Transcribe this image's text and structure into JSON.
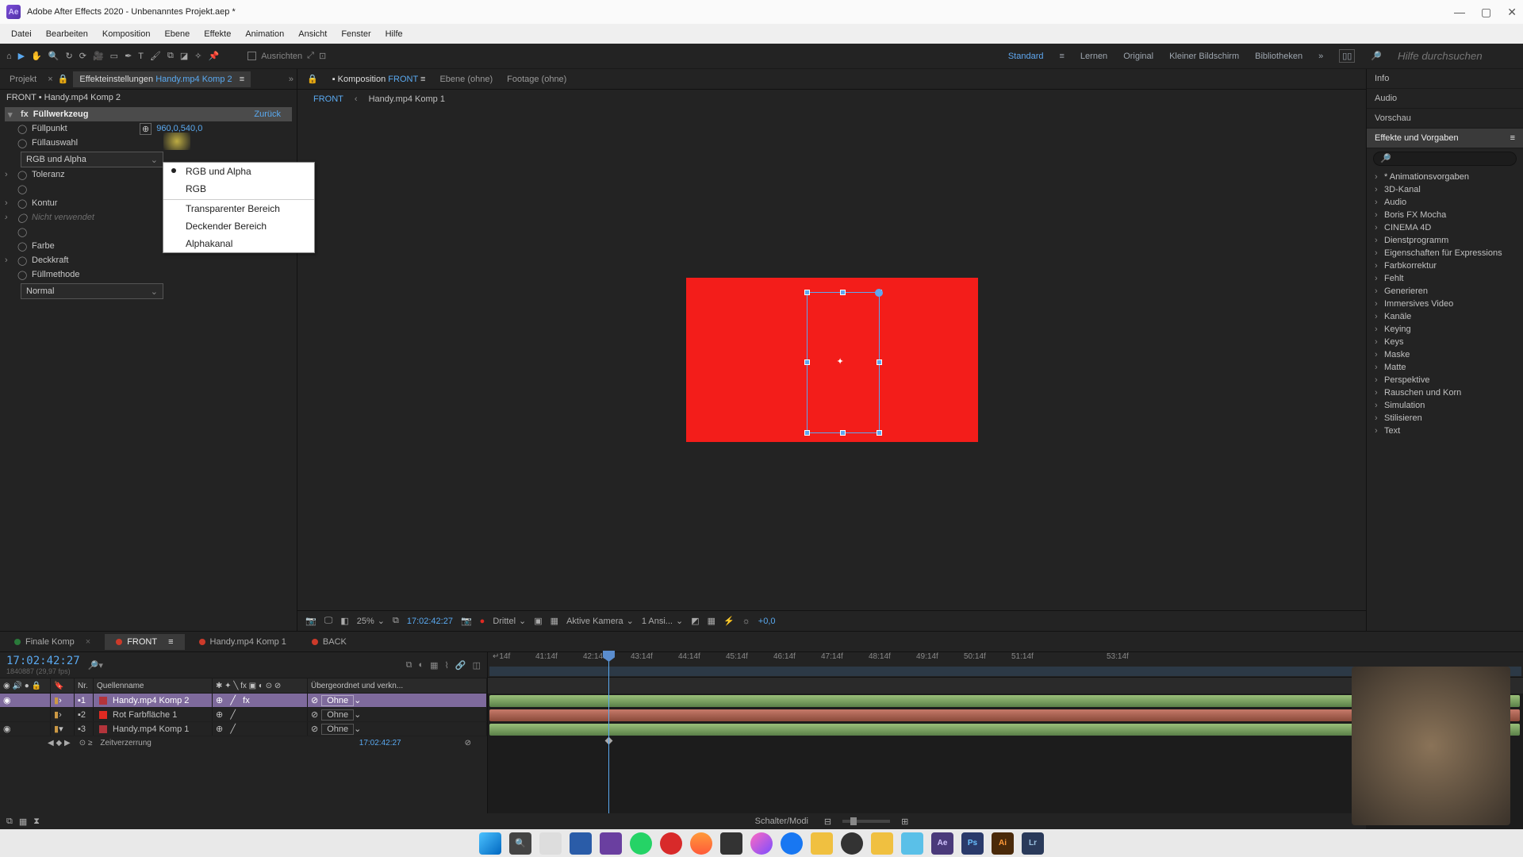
{
  "titlebar": {
    "logo_text": "Ae",
    "title": "Adobe After Effects 2020 - Unbenanntes Projekt.aep *"
  },
  "menu": {
    "items": [
      "Datei",
      "Bearbeiten",
      "Komposition",
      "Ebene",
      "Effekte",
      "Animation",
      "Ansicht",
      "Fenster",
      "Hilfe"
    ]
  },
  "toolbar": {
    "ausrichten": "Ausrichten",
    "workspaces": [
      "Standard",
      "Lernen",
      "Original",
      "Kleiner Bildschirm",
      "Bibliotheken"
    ],
    "search_placeholder": "Hilfe durchsuchen"
  },
  "left_panel": {
    "tabs": {
      "projekt": "Projekt",
      "effect_controls": "Effekteinstellungen",
      "effect_target": "Handy.mp4 Komp 2"
    },
    "crumb": "FRONT • Handy.mp4 Komp 2",
    "effect_name": "Füllwerkzeug",
    "reset_link": "Zurück",
    "fill_point_value": "960,0,540,0",
    "dropdown_selected": "RGB und Alpha",
    "dropdown_options": [
      "RGB und Alpha",
      "RGB",
      "Transparenter Bereich",
      "Deckender Bereich",
      "Alphakanal"
    ],
    "props": {
      "fillpoint": "Füllpunkt",
      "fillselect": "Füllauswahl",
      "tolerance": "Toleranz",
      "unused": "Nicht verwendet",
      "contour": "Kontur",
      "color": "Farbe",
      "opacity": "Deckkraft",
      "fillmethod": "Füllmethode"
    },
    "fillmethod_value": "Normal"
  },
  "viewer": {
    "tabs": {
      "komposition": "Komposition",
      "komp_target": "FRONT",
      "ebene": "Ebene (ohne)",
      "footage": "Footage (ohne)"
    },
    "breadcrumb": {
      "current": "FRONT",
      "chevron": "‹",
      "parent": "Handy.mp4 Komp 1"
    },
    "footer": {
      "zoom": "25%",
      "timecode": "17:02:42:27",
      "resolution": "Drittel",
      "camera": "Aktive Kamera",
      "views": "1 Ansi...",
      "exposure": "+0,0"
    }
  },
  "right_panel": {
    "heads": [
      "Info",
      "Audio",
      "Vorschau"
    ],
    "active_head": "Effekte und Vorgaben",
    "tree": [
      "* Animationsvorgaben",
      "3D-Kanal",
      "Audio",
      "Boris FX Mocha",
      "CINEMA 4D",
      "Dienstprogramm",
      "Eigenschaften für Expressions",
      "Farbkorrektur",
      "Fehlt",
      "Generieren",
      "Immersives Video",
      "Kanäle",
      "Keying",
      "Keys",
      "Maske",
      "Matte",
      "Perspektive",
      "Rauschen und Korn",
      "Simulation",
      "Stilisieren",
      "Text"
    ]
  },
  "timeline": {
    "tabs": [
      {
        "label": "Finale Komp",
        "color": "#2a7a3a"
      },
      {
        "label": "FRONT",
        "color": "#cc3a2a"
      },
      {
        "label": "Handy.mp4 Komp 1",
        "color": "#cc3a2a"
      },
      {
        "label": "BACK",
        "color": "#cc3a2a"
      }
    ],
    "active_tab_index": 1,
    "timecode": "17:02:42:27",
    "meta": "1840887 (29,97 fps)",
    "columns": {
      "nr": "Nr.",
      "name": "Quellenname",
      "parent": "Übergeordnet und verkn..."
    },
    "layers": [
      {
        "nr": "1",
        "name": "Handy.mp4 Komp 2",
        "color": "#b3343b",
        "parent": "Ohne",
        "selected": true,
        "has_fx": true
      },
      {
        "nr": "2",
        "name": "Rot Farbfläche 1",
        "color": "#e02a22",
        "parent": "Ohne",
        "selected": false,
        "has_fx": false
      },
      {
        "nr": "3",
        "name": "Handy.mp4 Komp 1",
        "color": "#b3343b",
        "parent": "Ohne",
        "selected": false,
        "has_fx": false
      }
    ],
    "sublayer": {
      "name": "Zeitverzerrung",
      "value": "17:02:42:27"
    },
    "ruler": [
      "↵14f",
      "41:14f",
      "42:14f",
      "43:14f",
      "44:14f",
      "45:14f",
      "46:14f",
      "47:14f",
      "48:14f",
      "49:14f",
      "50:14f",
      "51:14f",
      "",
      "53:14f"
    ]
  },
  "statusbar": {
    "mode": "Schalter/Modi"
  }
}
